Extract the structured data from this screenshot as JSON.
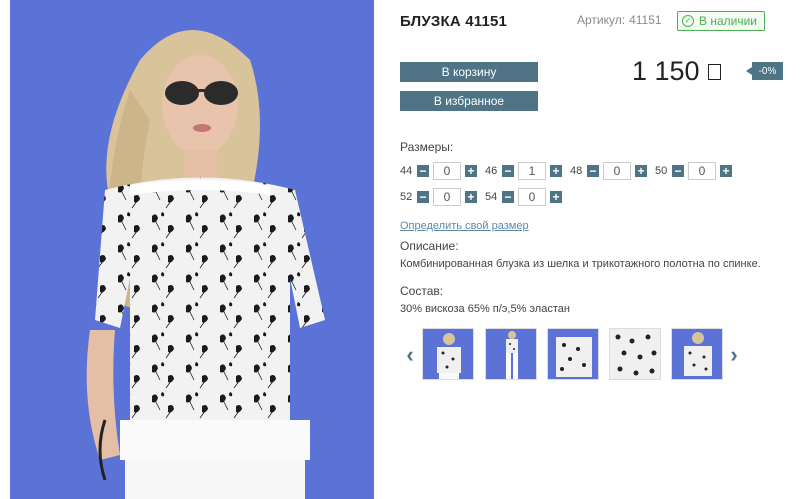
{
  "product": {
    "title": "БЛУЗКА 41151",
    "article_label": "Артикул:",
    "article_value": "41151",
    "stock_label": "В наличии",
    "price": "1 150",
    "discount": "-0%"
  },
  "buttons": {
    "cart_label": "В корзину",
    "favorite_label": "В избранное"
  },
  "sizes": {
    "label": "Размеры:",
    "items": [
      {
        "size": "44",
        "qty": "0"
      },
      {
        "size": "46",
        "qty": "1"
      },
      {
        "size": "48",
        "qty": "0"
      },
      {
        "size": "50",
        "qty": "0"
      },
      {
        "size": "52",
        "qty": "0"
      },
      {
        "size": "54",
        "qty": "0"
      }
    ],
    "define_size_link": "Определить свой размер"
  },
  "description": {
    "label": "Описание:",
    "text": "Комбинированная блузка из шелка и трикотажного полотна по спинке."
  },
  "composition": {
    "label": "Состав:",
    "text": "30% вискоза 65% п/э,5% эластан"
  },
  "gallery": {
    "thumbnail_count": 5,
    "prev_icon": "chevron-left-icon",
    "next_icon": "chevron-right-icon"
  },
  "colors": {
    "accent": "#4e7486",
    "stock_green": "#4caf50",
    "photo_background": "#5b73d6",
    "link": "#5d8aa8"
  }
}
